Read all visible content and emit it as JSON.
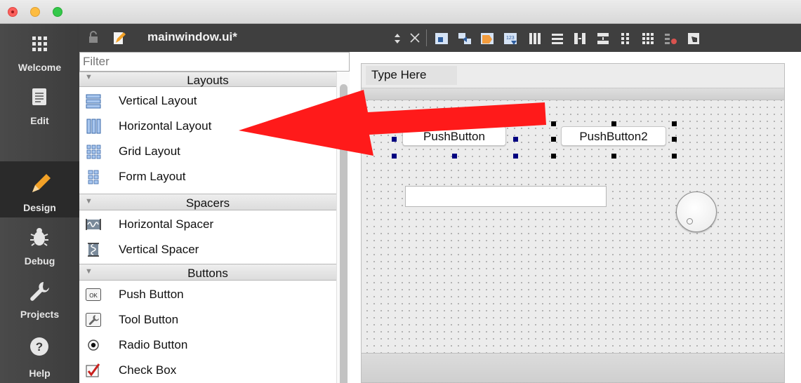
{
  "window": {
    "file_title": "mainwindow.ui*"
  },
  "modes": [
    {
      "label": "Welcome",
      "icon": "grid-icon",
      "active": false
    },
    {
      "label": "Edit",
      "icon": "document-icon",
      "active": false
    },
    {
      "label": "Design",
      "icon": "pencil-icon",
      "active": true
    },
    {
      "label": "Debug",
      "icon": "bug-icon",
      "active": false
    },
    {
      "label": "Projects",
      "icon": "wrench-icon",
      "active": false
    },
    {
      "label": "Help",
      "icon": "question-icon",
      "active": false
    }
  ],
  "widgetbox": {
    "filter_placeholder": "Filter",
    "categories": [
      {
        "label": "Layouts",
        "items": [
          {
            "label": "Vertical Layout",
            "icon": "vertical-layout-icon"
          },
          {
            "label": "Horizontal Layout",
            "icon": "horizontal-layout-icon"
          },
          {
            "label": "Grid Layout",
            "icon": "grid-layout-icon"
          },
          {
            "label": "Form Layout",
            "icon": "form-layout-icon"
          }
        ]
      },
      {
        "label": "Spacers",
        "items": [
          {
            "label": "Horizontal Spacer",
            "icon": "horizontal-spacer-icon"
          },
          {
            "label": "Vertical Spacer",
            "icon": "vertical-spacer-icon"
          }
        ]
      },
      {
        "label": "Buttons",
        "items": [
          {
            "label": "Push Button",
            "icon": "push-button-icon"
          },
          {
            "label": "Tool Button",
            "icon": "tool-button-icon"
          },
          {
            "label": "Radio Button",
            "icon": "radio-button-icon"
          },
          {
            "label": "Check Box",
            "icon": "check-box-icon"
          }
        ]
      }
    ]
  },
  "form": {
    "menu_placeholder": "Type Here",
    "button1": "PushButton",
    "button2": "PushButton2"
  },
  "colors": {
    "annotation_arrow": "#ff1a1a",
    "mode_bar": "#444444",
    "selection_handle": "#000080"
  }
}
